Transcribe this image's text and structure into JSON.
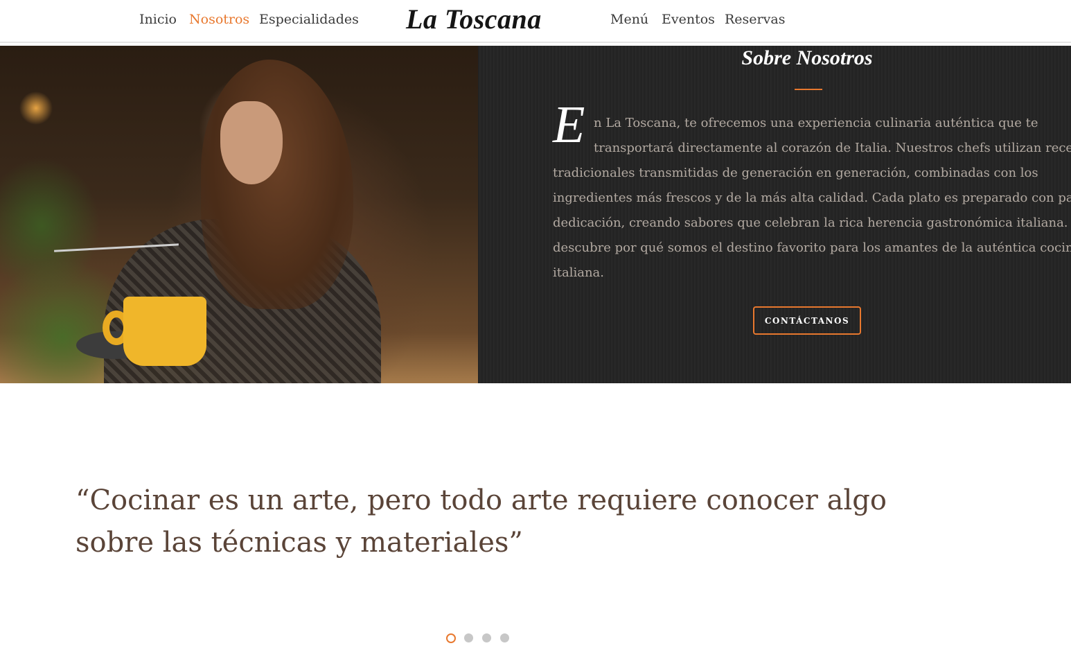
{
  "header": {
    "logo": "La Toscana",
    "nav_left": [
      "Inicio",
      "Nosotros",
      "Especialidades"
    ],
    "nav_right": [
      "Menú",
      "Eventos",
      "Reservas"
    ],
    "active_item": "Nosotros"
  },
  "about": {
    "title": "Sobre Nosotros",
    "drop_cap": "E",
    "text_lines": [
      "n La Toscana, te ofrecemos una experiencia culinaria auténtica que te",
      "transportará directamente al corazón de Italia. Nuestros chefs utilizan recetas",
      "tradicionales transmitidas de generación en generación, combinadas con los",
      "ingredientes más frescos y de la más alta calidad. Cada plato es preparado con pasión y",
      "dedicación, creando sabores que celebran la rica herencia gastronómica italiana. Ven y",
      "descubre por qué somos el destino favorito para los amantes de la auténtica cocina",
      "italiana."
    ],
    "button_label": "CONTÁCTANOS"
  },
  "quote": {
    "lines": [
      "“Cocinar es un arte, pero todo arte requiere conocer algo",
      "sobre las técnicas y materiales”"
    ]
  },
  "carousel": {
    "total": 4,
    "active_index": 0
  },
  "colors": {
    "accent": "#e8782e",
    "dark_panel": "#262626",
    "quote_text": "#5a4438"
  }
}
